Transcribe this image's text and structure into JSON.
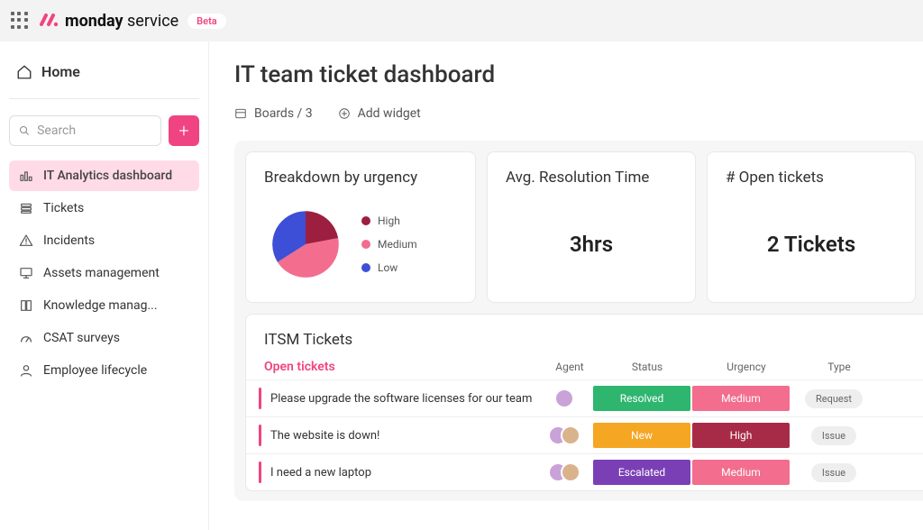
{
  "header": {
    "brand_bold": "monday",
    "brand_rest": " service",
    "beta": "Beta"
  },
  "sidebar": {
    "home": "Home",
    "search_placeholder": "Search",
    "items": [
      {
        "label": "IT Analytics dashboard",
        "icon": "bar-chart-icon"
      },
      {
        "label": "Tickets",
        "icon": "stack-icon"
      },
      {
        "label": "Incidents",
        "icon": "warning-icon"
      },
      {
        "label": "Assets management",
        "icon": "monitor-icon"
      },
      {
        "label": "Knowledge manag...",
        "icon": "book-icon"
      },
      {
        "label": "CSAT surveys",
        "icon": "gauge-icon"
      },
      {
        "label": "Employee lifecycle",
        "icon": "person-icon"
      }
    ]
  },
  "page": {
    "title": "IT team ticket dashboard",
    "toolbar": {
      "boards": "Boards / 3",
      "add_widget": "Add widget"
    }
  },
  "cards": {
    "breakdown": {
      "title": "Breakdown by urgency",
      "legend": [
        {
          "label": "High",
          "color": "#9c1f3f"
        },
        {
          "label": "Medium",
          "color": "#f26d8e"
        },
        {
          "label": "Low",
          "color": "#3d4fd6"
        }
      ]
    },
    "avg": {
      "title": "Avg. Resolution Time",
      "value": "3hrs"
    },
    "open": {
      "title": "# Open tickets",
      "value": "2 Tickets"
    }
  },
  "chart_data": {
    "type": "pie",
    "title": "Breakdown by urgency",
    "series": [
      {
        "name": "High",
        "value": 22,
        "color": "#9c1f3f"
      },
      {
        "name": "Medium",
        "value": 44,
        "color": "#f26d8e"
      },
      {
        "name": "Low",
        "value": 34,
        "color": "#3d4fd6"
      }
    ]
  },
  "tickets": {
    "card_title": "ITSM Tickets",
    "section": "Open tickets",
    "columns": {
      "agent": "Agent",
      "status": "Status",
      "urgency": "Urgency",
      "type": "Type"
    },
    "rows": [
      {
        "title": "Please upgrade the software licenses for our team",
        "agents": 1,
        "status": "Resolved",
        "status_class": "c-green",
        "urgency": "Medium",
        "urgency_class": "c-pink",
        "type": "Request"
      },
      {
        "title": "The website is down!",
        "agents": 2,
        "status": "New",
        "status_class": "c-orange",
        "urgency": "High",
        "urgency_class": "c-darkred",
        "type": "Issue"
      },
      {
        "title": "I need a new laptop",
        "agents": 2,
        "status": "Escalated",
        "status_class": "c-purple",
        "urgency": "Medium",
        "urgency_class": "c-pink",
        "type": "Issue"
      }
    ]
  }
}
